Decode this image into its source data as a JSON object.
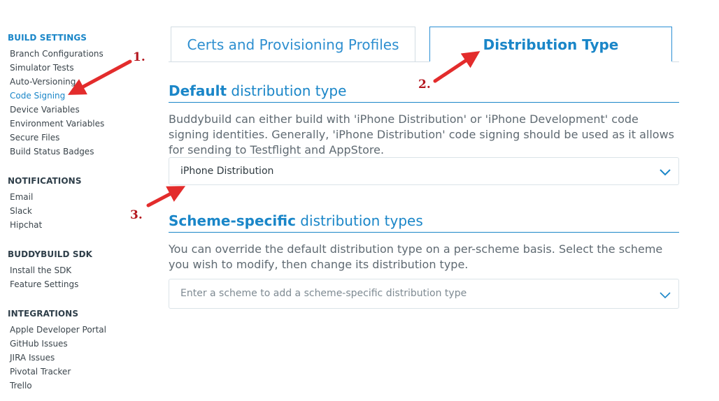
{
  "sidebar": {
    "sections": [
      {
        "title": "BUILD SETTINGS",
        "items": [
          "Branch Configurations",
          "Simulator Tests",
          "Auto-Versioning",
          "Code Signing",
          "Device Variables",
          "Environment Variables",
          "Secure Files",
          "Build Status Badges"
        ]
      },
      {
        "title": "NOTIFICATIONS",
        "items": [
          "Email",
          "Slack",
          "Hipchat"
        ]
      },
      {
        "title": "BUDDYBUILD SDK",
        "items": [
          "Install the SDK",
          "Feature Settings"
        ]
      },
      {
        "title": "INTEGRATIONS",
        "items": [
          "Apple Developer Portal",
          "GitHub Issues",
          "JIRA Issues",
          "Pivotal Tracker",
          "Trello"
        ]
      }
    ],
    "active_item": "Code Signing"
  },
  "tabs": [
    {
      "label": "Certs and Provisioning Profiles",
      "active": false
    },
    {
      "label": "Distribution Type",
      "active": true
    }
  ],
  "default_section": {
    "heading_bold": "Default",
    "heading_rest": " distribution type",
    "description": "Buddybuild can either build with 'iPhone Distribution' or 'iPhone Development' code signing identities. Generally, 'iPhone Distribution' code signing should be used as it allows for sending to Testflight and AppStore.",
    "select_value": "iPhone Distribution"
  },
  "scheme_section": {
    "heading_bold": "Scheme-specific",
    "heading_rest": " distribution types",
    "description": "You can override the default distribution type on a per-scheme basis. Select the scheme you wish to modify, then change its distribution type.",
    "select_placeholder": "Enter a scheme to add a scheme-specific distribution type"
  },
  "annotations": [
    "1.",
    "2.",
    "3."
  ],
  "colors": {
    "accent": "#1a86c8",
    "annotation": "#e32c2c"
  }
}
